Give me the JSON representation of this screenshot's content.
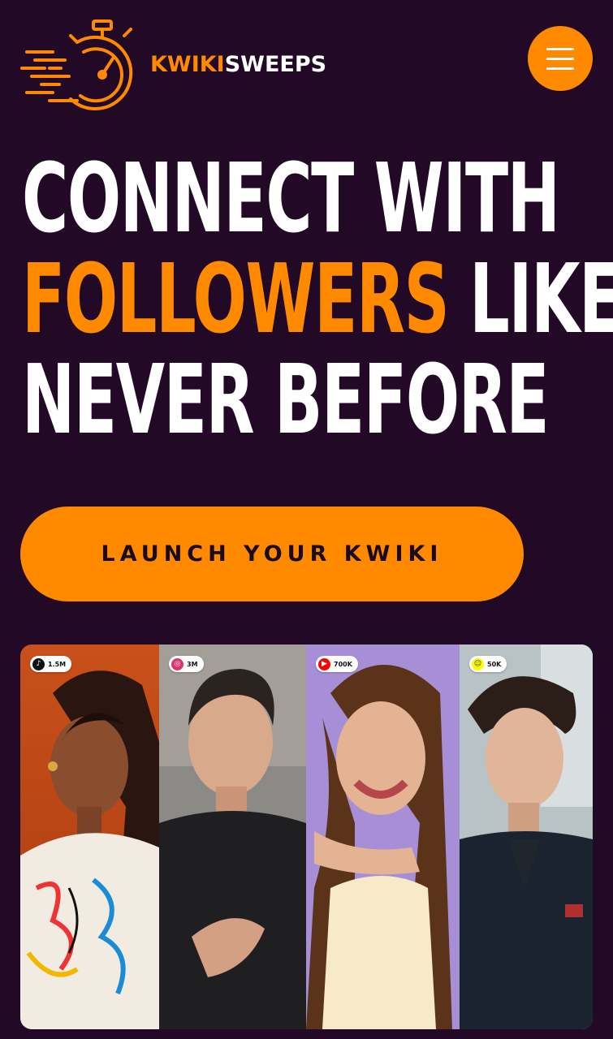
{
  "brand": {
    "name_part1": "KWIKI",
    "name_part2": "SWEEPS",
    "accent_color": "#ff8a00",
    "background_color": "#220a27",
    "logo_icon": "stopwatch-icon"
  },
  "header": {
    "menu_icon": "hamburger-menu-icon"
  },
  "hero": {
    "line1": "CONNECT WITH",
    "line2_accent": "FOLLOWERS",
    "line2_rest": " LIKE",
    "line3": "NEVER BEFORE"
  },
  "cta": {
    "label": "LAUNCH YOUR KWIKI"
  },
  "gallery": {
    "cards": [
      {
        "platform_icon": "tiktok-icon",
        "platform_color": "#111111",
        "followers": "1.5M"
      },
      {
        "platform_icon": "instagram-icon",
        "platform_color": "#e1306c",
        "followers": "3M"
      },
      {
        "platform_icon": "youtube-icon",
        "platform_color": "#ff0000",
        "followers": "700K"
      },
      {
        "platform_icon": "snapchat-icon",
        "platform_color": "#fffc00",
        "followers": "50K"
      }
    ]
  }
}
